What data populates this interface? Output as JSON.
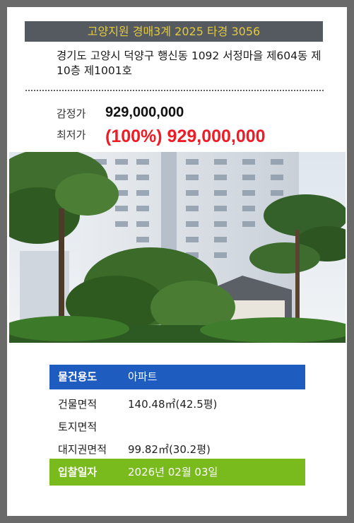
{
  "header": {
    "case_title": "고양지원 경매3계 2025 타경 3056"
  },
  "property": {
    "address": "경기도 고양시 덕양구 행신동 1092 서정마을 제604동 제10층 제1001호"
  },
  "prices": {
    "appraisal_label": "감정가",
    "appraisal_value": "929,000,000",
    "minimum_label": "최저가",
    "minimum_value": "(100%) 929,000,000"
  },
  "photo": {
    "subject": "apartment-building-photo"
  },
  "details": {
    "usage_label": "물건용도",
    "usage_value": "아파트",
    "building_area_label": "건물면적",
    "building_area_value": "140.48㎡(42.5평)",
    "land_area_label": "토지면적",
    "land_area_value": "",
    "land_right_label": "대지권면적",
    "land_right_value": "99.82㎡(30.2평)",
    "bid_date_label": "입찰일자",
    "bid_date_value": "2026년 02월 03일"
  },
  "colors": {
    "header_bg": "#555a60",
    "header_text": "#e4c93a",
    "minimum_price": "#ee1c25",
    "usage_row_bg": "#1f5cbf",
    "bid_row_bg": "#79ba1d"
  }
}
